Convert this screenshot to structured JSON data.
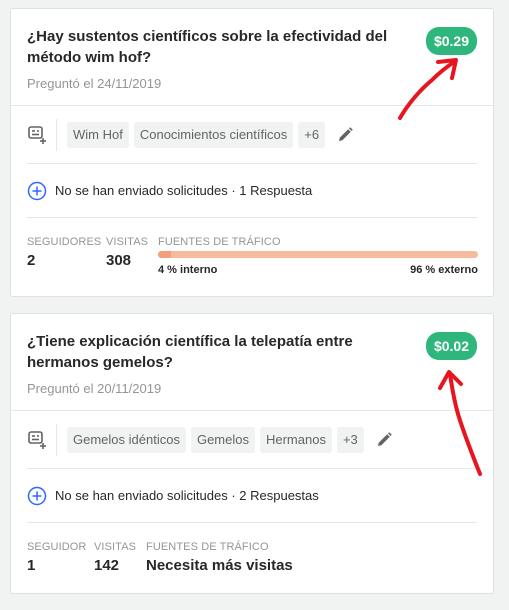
{
  "questions": [
    {
      "title": "¿Hay sustentos científicos sobre la efectividad del método wim hof?",
      "date": "Preguntó el 24/11/2019",
      "price": "$0.29",
      "tags": [
        "Wim Hof",
        "Conocimientos científicos",
        "+6"
      ],
      "requests": "No se han enviado solicitudes · 1 Respuesta",
      "stats": {
        "followers_label": "SEGUIDORES",
        "followers": "2",
        "views_label": "VISITAS",
        "views": "308",
        "traffic_label": "FUENTES DE TRÁFICO",
        "internal": "4 % interno",
        "external": "96 % externo",
        "internal_fraction": 0.04
      }
    },
    {
      "title": "¿Tiene explicación científica la telepatía entre hermanos gemelos?",
      "date": "Preguntó el 20/11/2019",
      "price": "$0.02",
      "tags": [
        "Gemelos idénticos",
        "Gemelos",
        "Hermanos",
        "+3"
      ],
      "requests": "No se han enviado solicitudes · 2 Respuestas",
      "stats": {
        "followers_label": "SEGUIDOR",
        "followers": "1",
        "views_label": "VISITAS",
        "views": "142",
        "traffic_label": "FUENTES DE TRÁFICO",
        "traffic_note": "Necesita más visitas"
      }
    }
  ],
  "colors": {
    "price_badge": "#2eb67d",
    "annotation_arrow": "#e8141e",
    "traffic_bar": "#f6bb9c",
    "add_icon": "#2e69ff"
  }
}
